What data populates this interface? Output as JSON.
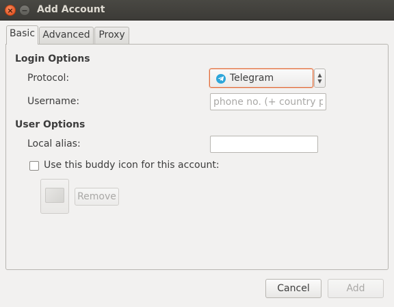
{
  "window": {
    "title": "Add Account",
    "close_glyph": "×",
    "minimize_glyph": "−"
  },
  "tabs": [
    {
      "label": "Basic",
      "active": true
    },
    {
      "label": "Advanced",
      "active": false
    },
    {
      "label": "Proxy",
      "active": false
    }
  ],
  "login_options": {
    "heading": "Login Options",
    "protocol_label": "Protocol:",
    "protocol_value": "Telegram",
    "protocol_icon": "telegram-icon",
    "username_label": "Username:",
    "username_placeholder": "phone no. (+ country prefix)",
    "username_value": ""
  },
  "user_options": {
    "heading": "User Options",
    "local_alias_label": "Local alias:",
    "local_alias_value": "",
    "buddy_icon_checkbox_label": "Use this buddy icon for this account:",
    "buddy_icon_checked": false,
    "remove_button_label": "Remove"
  },
  "footer": {
    "cancel_label": "Cancel",
    "add_label": "Add"
  },
  "colors": {
    "titlebar": "#3c3b37",
    "close_button": "#e0481a",
    "focus_border": "#e06a38",
    "telegram": "#2ea6da"
  }
}
